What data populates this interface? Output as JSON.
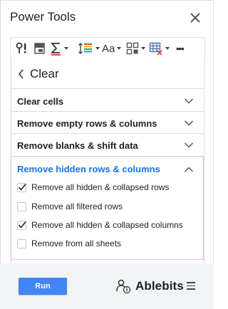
{
  "app": {
    "title": "Power Tools"
  },
  "toolbar": {
    "tools": [
      {
        "icon": "text-tools-icon"
      },
      {
        "icon": "dedupe-icon"
      },
      {
        "icon": "sum-formula-icon"
      },
      {
        "icon": "sort-icon"
      },
      {
        "icon": "text-case-icon",
        "label": "Aa"
      },
      {
        "icon": "split-merge-icon"
      },
      {
        "icon": "clear-table-icon"
      },
      {
        "icon": "more-icon",
        "label": "•••"
      }
    ]
  },
  "nav": {
    "back_label": "Clear"
  },
  "sections": [
    {
      "label": "Clear cells",
      "expanded": false
    },
    {
      "label": "Remove empty rows & columns",
      "expanded": false
    },
    {
      "label": "Remove blanks & shift data",
      "expanded": false
    },
    {
      "label": "Remove hidden rows & columns",
      "expanded": true
    }
  ],
  "options": [
    {
      "label": "Remove all hidden & collapsed rows",
      "checked": true
    },
    {
      "label": "Remove all filtered rows",
      "checked": false
    },
    {
      "label": "Remove all hidden & collapsed columns",
      "checked": true
    },
    {
      "label": "Remove from all sheets",
      "checked": false
    }
  ],
  "footer": {
    "run_label": "Run",
    "brand": "Ablebits"
  },
  "colors": {
    "accent": "#1a73e8",
    "run_button": "#4285f4",
    "panel_bg": "#f1f3f4",
    "highlight_border": "#f4b7d9"
  }
}
